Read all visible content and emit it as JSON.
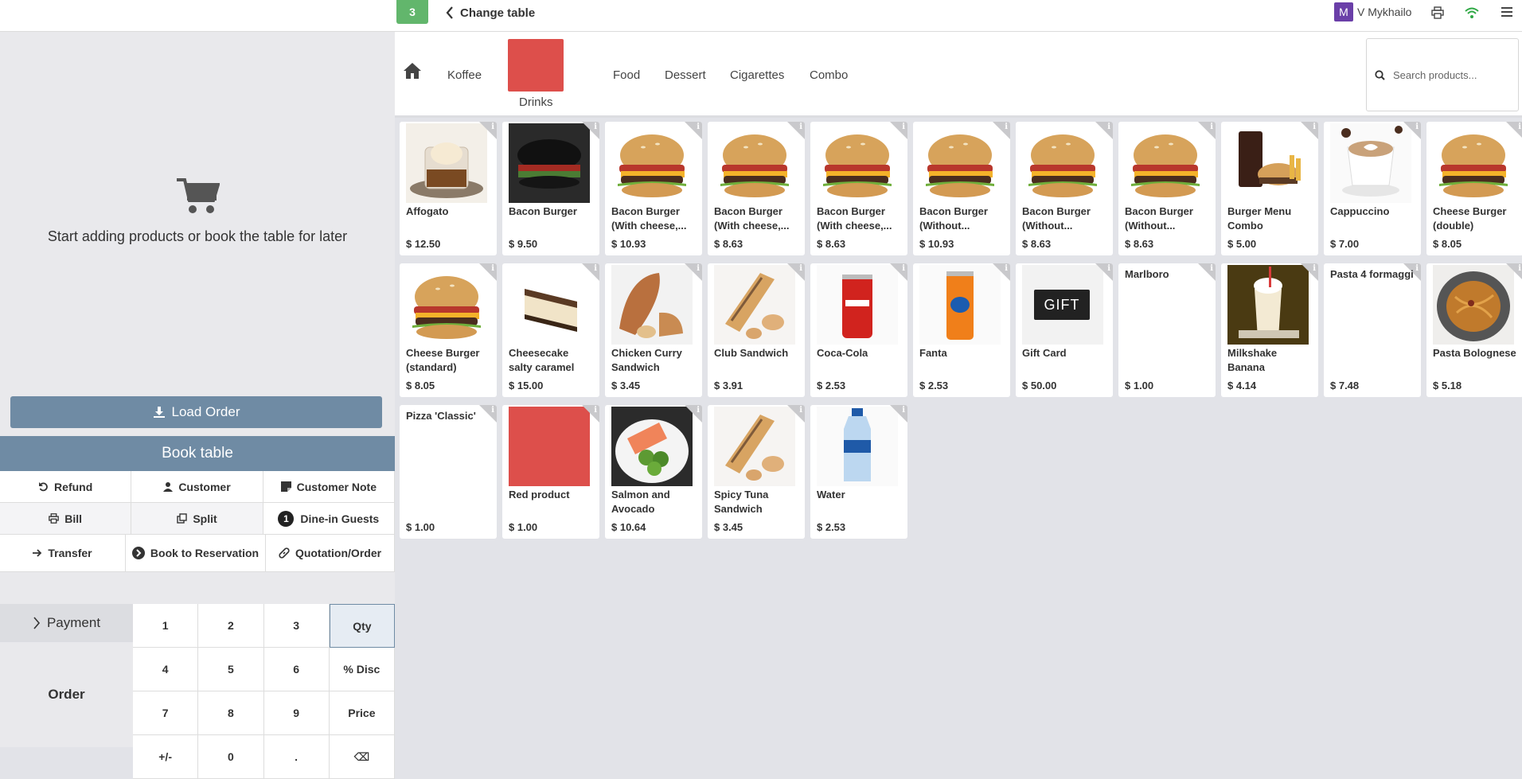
{
  "header": {
    "table_number": "3",
    "change_table_label": "Change table",
    "user_initial": "M",
    "user_name": "V Mykhailo"
  },
  "left": {
    "empty_message": "Start adding products or book the table for later",
    "load_order": "Load Order",
    "book_table": "Book table",
    "controls_row1": [
      "Refund",
      "Customer",
      "Customer Note"
    ],
    "controls_row2": [
      "Bill",
      "Split",
      "Dine-in Guests"
    ],
    "guests_count": "1",
    "controls_row3": [
      "Transfer",
      "Book to Reservation",
      "Quotation/Order"
    ],
    "payment": "Payment",
    "order": "Order",
    "numpad": [
      "1",
      "2",
      "3",
      "Qty",
      "4",
      "5",
      "6",
      "% Disc",
      "7",
      "8",
      "9",
      "Price",
      "+/-",
      "0",
      ".",
      "⌫"
    ]
  },
  "categories": [
    "Koffee",
    "Drinks",
    "Food",
    "Dessert",
    "Cigarettes",
    "Combo"
  ],
  "search": {
    "placeholder": "Search products..."
  },
  "colors": {
    "accent": "#6f8ba4",
    "badge": "#62b66c",
    "red_swatch": "#dd4f4b"
  },
  "products": [
    {
      "name": "Affogato",
      "price": "$ 12.50",
      "img": "affogato"
    },
    {
      "name": "Bacon Burger",
      "price": "$ 9.50",
      "img": "black-burger"
    },
    {
      "name": "Bacon Burger (With cheese,...",
      "price": "$ 10.93",
      "img": "burger"
    },
    {
      "name": "Bacon Burger (With cheese,...",
      "price": "$ 8.63",
      "img": "burger"
    },
    {
      "name": "Bacon Burger (With cheese,...",
      "price": "$ 8.63",
      "img": "burger"
    },
    {
      "name": "Bacon Burger (Without...",
      "price": "$ 10.93",
      "img": "burger"
    },
    {
      "name": "Bacon Burger (Without...",
      "price": "$ 8.63",
      "img": "burger"
    },
    {
      "name": "Bacon Burger (Without...",
      "price": "$ 8.63",
      "img": "burger"
    },
    {
      "name": "Burger Menu Combo",
      "price": "$ 5.00",
      "img": "combo"
    },
    {
      "name": "Cappuccino",
      "price": "$ 7.00",
      "img": "cappuccino"
    },
    {
      "name": "Cheese Burger (double)",
      "price": "$ 8.05",
      "img": "burger"
    },
    {
      "name": "Cheese Burger (standard)",
      "price": "$ 8.05",
      "img": "burger"
    },
    {
      "name": "Cheesecake salty caramel",
      "price": "$ 15.00",
      "img": "cheesecake"
    },
    {
      "name": "Chicken Curry Sandwich",
      "price": "$ 3.45",
      "img": "sandwich"
    },
    {
      "name": "Club Sandwich",
      "price": "$ 3.91",
      "img": "baguette"
    },
    {
      "name": "Coca-Cola",
      "price": "$ 2.53",
      "img": "coke"
    },
    {
      "name": "Fanta",
      "price": "$ 2.53",
      "img": "fanta"
    },
    {
      "name": "Gift Card",
      "price": "$ 50.00",
      "img": "gift",
      "img_text": "GIFT"
    },
    {
      "name": "Marlboro",
      "price": "$ 1.00",
      "img": "none"
    },
    {
      "name": "Milkshake Banana",
      "price": "$ 4.14",
      "img": "milkshake"
    },
    {
      "name": "Pasta 4 formaggi",
      "price": "$ 7.48",
      "img": "none"
    },
    {
      "name": "Pasta Bolognese",
      "price": "$ 5.18",
      "img": "pasta"
    },
    {
      "name": "Pizza 'Classic'",
      "price": "$ 1.00",
      "img": "none"
    },
    {
      "name": "Red product",
      "price": "$ 1.00",
      "img": "red"
    },
    {
      "name": "Salmon and Avocado",
      "price": "$ 10.64",
      "img": "salmon"
    },
    {
      "name": "Spicy Tuna Sandwich",
      "price": "$ 3.45",
      "img": "baguette"
    },
    {
      "name": "Water",
      "price": "$ 2.53",
      "img": "water"
    }
  ]
}
